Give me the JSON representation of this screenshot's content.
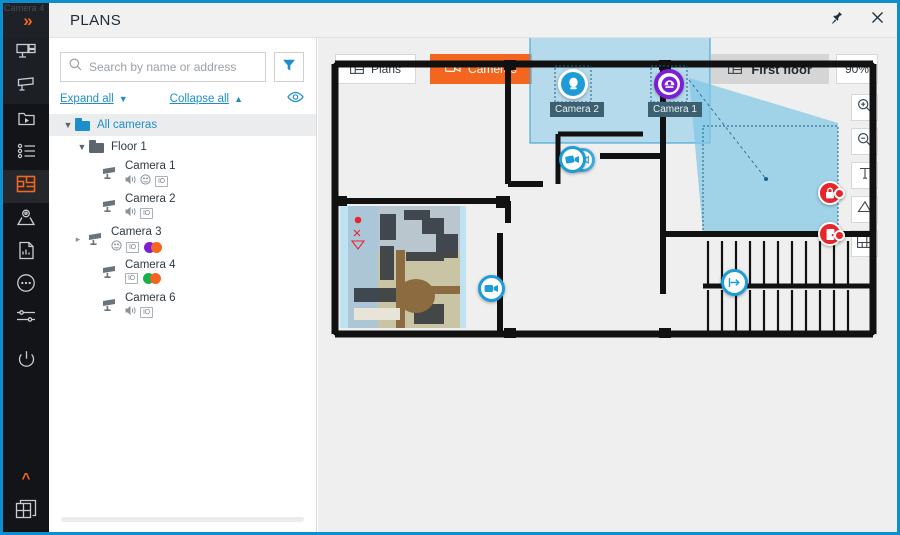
{
  "window": {
    "title": "PLANS",
    "pin_icon": "pin-icon",
    "close_icon": "close-icon",
    "accent": "#0d8ecf"
  },
  "rail": {
    "ghost_label": "Camera 4",
    "expand_icon": "chevron-double-right-icon",
    "collapse_caret_icon": "chevron-up-icon",
    "items": [
      {
        "name": "video-wall-icon",
        "label": "Video wall"
      },
      {
        "name": "camera-icon",
        "label": "Cameras"
      },
      {
        "name": "archive-folder-icon",
        "label": "Archive"
      },
      {
        "name": "event-list-icon",
        "label": "Events"
      },
      {
        "name": "plans-icon",
        "label": "Plans",
        "active": true
      },
      {
        "name": "map-pin-icon",
        "label": "Maps"
      },
      {
        "name": "report-icon",
        "label": "Reports"
      },
      {
        "name": "more-dots-icon",
        "label": "More"
      },
      {
        "name": "settings-sliders-icon",
        "label": "Settings"
      },
      {
        "name": "power-icon",
        "label": "Power"
      },
      {
        "name": "layout-grid-icon",
        "label": "Layouts"
      }
    ]
  },
  "sidebar": {
    "search": {
      "placeholder": "Search by name or address",
      "value": "",
      "icon": "search-icon"
    },
    "filter_icon": "filter-funnel-icon",
    "expand_all": "Expand all",
    "collapse_all": "Collapse all",
    "expand_icon": "chevron-down-icon",
    "collapse_icon": "chevron-up-icon",
    "visibility_icon": "eye-icon",
    "tree": {
      "root": {
        "label": "All cameras",
        "icon": "folder-blue-icon",
        "selected": true,
        "twist": "chevron-down-icon"
      },
      "group": {
        "label": "Floor 1",
        "icon": "folder-grey-icon",
        "twist": "chevron-down-icon"
      },
      "cameras": [
        {
          "label": "Camera 1",
          "icon": "camera-icon",
          "twist": "",
          "badges": [
            "speaker-icon",
            "face-icon",
            "IO"
          ],
          "dots": []
        },
        {
          "label": "Camera 2",
          "icon": "camera-icon",
          "twist": "",
          "badges": [
            "speaker-icon",
            "IO"
          ],
          "dots": []
        },
        {
          "label": "Camera 3",
          "icon": "camera-icon",
          "twist": "chevron-right-icon",
          "badges": [
            "face-icon",
            "IO"
          ],
          "dots": [
            "#7b1fd6",
            "#f4661f"
          ]
        },
        {
          "label": "Camera 4",
          "icon": "camera-icon",
          "twist": "",
          "badges": [
            "IO"
          ],
          "dots": [
            "#17b04b",
            "#f4661f"
          ]
        },
        {
          "label": "Camera 6",
          "icon": "camera-icon",
          "twist": "",
          "badges": [
            "speaker-icon",
            "IO"
          ],
          "dots": []
        }
      ]
    }
  },
  "toolbar": {
    "plans_label": "Plans",
    "plans_icon": "plan-grid-icon",
    "cameras_label": "Cameras",
    "cameras_icon": "video-camera-icon",
    "floor_label": "First floor",
    "floor_icon": "plan-grid-icon",
    "zoom_value": "90%",
    "accent_orange": "#f4661f",
    "tools": [
      {
        "name": "zoom-in-icon",
        "label": "Zoom in"
      },
      {
        "name": "zoom-out-icon",
        "label": "Zoom out"
      },
      {
        "name": "text-tool-icon",
        "label": "Text"
      },
      {
        "name": "angle-tool-icon",
        "label": "Angle"
      },
      {
        "name": "plan-layout-icon",
        "label": "Plan layout"
      }
    ]
  },
  "map": {
    "markers": [
      {
        "id": "camera-2",
        "name": "camera-2-marker",
        "label": "Camera 2",
        "kind": "dome-blue",
        "icon": "dome-camera-icon",
        "color": "#1e9cd7",
        "selected": true
      },
      {
        "id": "camera-1",
        "name": "camera-1-marker",
        "label": "Camera 1",
        "kind": "dome-purple",
        "icon": "dome-camera-icon",
        "color": "#7b1fd6",
        "selected": true
      },
      {
        "id": "camera-group",
        "name": "camera-group-marker",
        "label": "",
        "kind": "cluster-blue",
        "icon": "video-camera-icon",
        "color": "#1e9cd7",
        "selected": false
      },
      {
        "id": "camera-left",
        "name": "camera-left-marker",
        "label": "",
        "kind": "box-blue",
        "icon": "video-camera-icon",
        "color": "#1e9cd7",
        "selected": false
      },
      {
        "id": "door-lock",
        "name": "door-lock-marker",
        "label": "",
        "kind": "red",
        "icon": "lock-icon",
        "color": "#e8252b",
        "selected": false
      },
      {
        "id": "door-sensor",
        "name": "door-sensor-marker",
        "label": "",
        "kind": "red",
        "icon": "door-icon",
        "color": "#e8252b",
        "selected": false
      },
      {
        "id": "exit",
        "name": "exit-marker",
        "label": "",
        "kind": "white-blue",
        "icon": "exit-arrow-icon",
        "color": "#1e9cd7",
        "selected": false
      }
    ],
    "preview": {
      "name": "camera-live-preview",
      "label": ""
    },
    "fov_color": "#7ec8e8",
    "selection_color": "#aadcf0"
  }
}
